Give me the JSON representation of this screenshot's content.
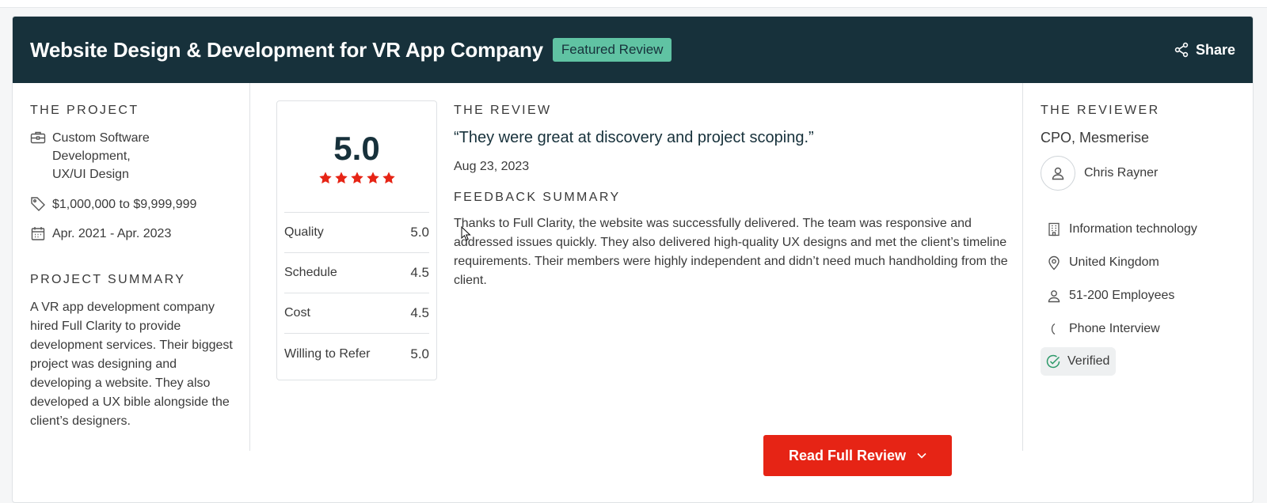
{
  "header": {
    "title": "Website Design & Development for VR App Company",
    "badge": "Featured Review",
    "share_label": "Share"
  },
  "project": {
    "section_label": "THE PROJECT",
    "services_line1": "Custom Software",
    "services_line2": "Development,",
    "services_line3": "UX/UI Design",
    "budget": "$1,000,000 to $9,999,999",
    "dates": "Apr. 2021 - Apr. 2023",
    "summary_label": "PROJECT SUMMARY",
    "summary": "A VR app development company hired Full Clarity to provide development services. Their biggest project was designing and developing a website. They also developed a UX bible alongside the client’s designers."
  },
  "ratings": {
    "overall": "5.0",
    "stars": 5,
    "star_color": "#e62415",
    "metrics": [
      {
        "label": "Quality",
        "value": "5.0"
      },
      {
        "label": "Schedule",
        "value": "4.5"
      },
      {
        "label": "Cost",
        "value": "4.5"
      },
      {
        "label": "Willing to Refer",
        "value": "5.0"
      }
    ]
  },
  "review": {
    "section_label": "THE REVIEW",
    "quote": "“They were great at discovery and project scoping.”",
    "date": "Aug 23, 2023",
    "feedback_label": "FEEDBACK SUMMARY",
    "feedback": "Thanks to Full Clarity, the website was successfully delivered. The team was responsive and addressed issues quickly. They also delivered high-quality UX designs and met the client’s timeline requirements. Their members were highly independent and didn’t need much handholding from the client."
  },
  "reviewer": {
    "section_label": "THE REVIEWER",
    "title": "CPO, Mesmerise",
    "name": "Chris Rayner",
    "industry": "Information technology",
    "location": "United Kingdom",
    "size": "51-200 Employees",
    "interview": "Phone Interview",
    "verified": "Verified"
  },
  "actions": {
    "read_full_review": "Read Full Review"
  },
  "colors": {
    "header_bg": "#17313b",
    "badge_bg": "#60c3a3",
    "button_bg": "#e62415"
  }
}
